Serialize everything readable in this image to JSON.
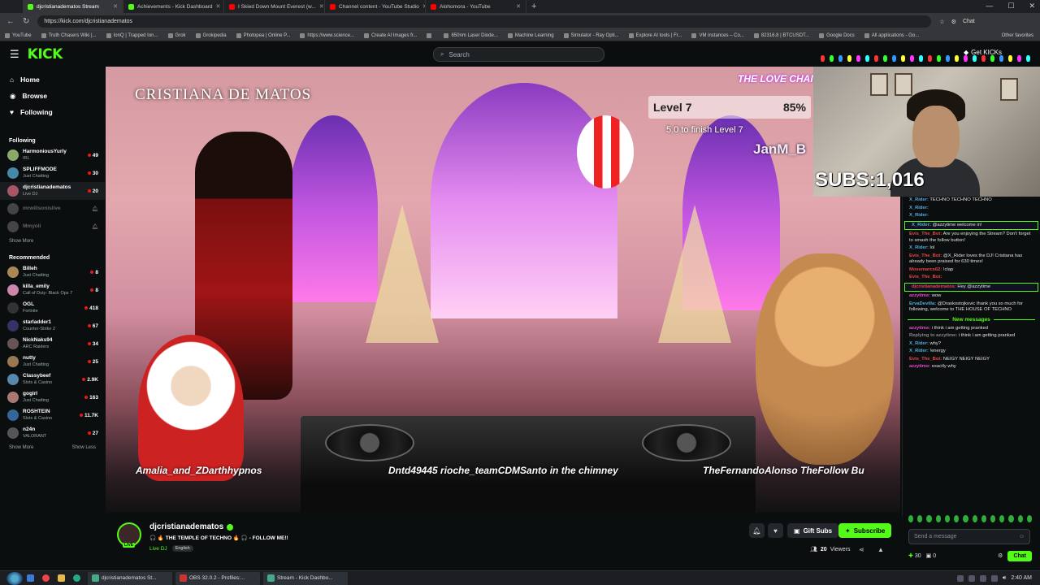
{
  "browser": {
    "tabs": [
      {
        "label": "djcristianadematos Stream",
        "color": "#53fc18",
        "active": true
      },
      {
        "label": "Achievements - Kick Dashboard",
        "color": "#53fc18"
      },
      {
        "label": "I Skied Down Mount Everest (w...",
        "color": "#ff0000"
      },
      {
        "label": "Channel content - YouTube Studio",
        "color": "#ff0000"
      },
      {
        "label": "Alohomora - YouTube",
        "color": "#ff0000"
      }
    ],
    "new_tab": "+",
    "url": "https://kick.com/djcristianadematos",
    "account_label": "Chat",
    "bookmarks": [
      "YouTube",
      "Truth Chasers Wiki |...",
      "IonQ | Trapped Ion...",
      "Grok",
      "Grokipedia",
      "Photopea | Online P...",
      "https://www.science...",
      "Create AI Images fr...",
      "",
      "650nm Laser Diode...",
      "Machine Learning",
      "Simulator - Ray Opti...",
      "Explore AI tools | Fr...",
      "VM instances – Co...",
      "82316.8 | BTCUSDT...",
      "Google Docs",
      "All applications - Go..."
    ],
    "other_favorites": "Other favorites"
  },
  "kick": {
    "logo": "KICK",
    "search_placeholder": "Search",
    "get_kicks": "Get KICKs",
    "nav": [
      {
        "label": "Home",
        "icon": "home-icon"
      },
      {
        "label": "Browse",
        "icon": "browse-icon"
      },
      {
        "label": "Following",
        "icon": "heart-icon"
      }
    ],
    "following_header": "Following",
    "following": [
      {
        "name": "HarmoniousYurly",
        "category": "IRL",
        "viewers": "49",
        "color": "#8a6"
      },
      {
        "name": "SPLIFFMODE",
        "category": "Just Chatting",
        "viewers": "30",
        "color": "#48a"
      },
      {
        "name": "djcristianadematos",
        "category": "Live DJ",
        "viewers": "20",
        "color": "#a56",
        "selected": true
      },
      {
        "name": "mrwillsonislive",
        "category": "",
        "viewers": "",
        "color": "#444",
        "offline": true
      },
      {
        "name": "Mmyoli",
        "category": "",
        "viewers": "",
        "color": "#444",
        "offline": true
      }
    ],
    "show_more": "Show More",
    "recommended_header": "Recommended",
    "recommended": [
      {
        "name": "Billeh",
        "category": "Just Chatting",
        "viewers": "8",
        "color": "#a85"
      },
      {
        "name": "killa_emily",
        "category": "Call of Duty: Black Ops 7",
        "viewers": "8",
        "color": "#c8a"
      },
      {
        "name": "OGL",
        "category": "Fortnite",
        "viewers": "418",
        "color": "#333"
      },
      {
        "name": "starladder1",
        "category": "Counter-Strike 2",
        "viewers": "67",
        "color": "#336"
      },
      {
        "name": "NickNaks94",
        "category": "ARC Raiders",
        "viewers": "34",
        "color": "#655"
      },
      {
        "name": "nutty",
        "category": "Just Chatting",
        "viewers": "25",
        "color": "#975"
      },
      {
        "name": "Classybeef",
        "category": "Slots & Casino",
        "viewers": "2.9K",
        "color": "#58a"
      },
      {
        "name": "gogirl",
        "category": "Just Chatting",
        "viewers": "163",
        "color": "#a77"
      },
      {
        "name": "ROSHTEIN",
        "category": "Slots & Casino",
        "viewers": "11.7K",
        "color": "#369"
      },
      {
        "name": "n24n",
        "category": "VALORANT",
        "viewers": "27",
        "color": "#555"
      }
    ],
    "show_more2": "Show More",
    "show_less": "Show Less"
  },
  "video": {
    "performer_name": "CRISTIANA DE MATOS",
    "level_label": "Level 7",
    "level_pct": "85%",
    "level_sub": "5.0 to finish Level 7",
    "love_chain": "THE LOVE CHAIN",
    "janm": "JanM_B",
    "subs_label": "SUBS:1,016",
    "ticker": [
      "Amalia_and_ZDarthhypnos",
      "Dntd49445 rioche_teamCDMSanto in the chimney",
      "TheFernandoAlonso TheFollow Bu"
    ]
  },
  "chat": {
    "messages": [
      {
        "user": "X_Rider:",
        "text": "TECHNO TECHNO TECHNO",
        "color": "#5ad"
      },
      {
        "user": "X_Rider:",
        "text": "",
        "color": "#5ad"
      },
      {
        "user": "X_Rider:",
        "text": "",
        "color": "#5ad"
      },
      {
        "user": "X_Rider:",
        "text": "@azzytime welcome in!",
        "color": "#5ad",
        "hl": true
      },
      {
        "user": "Evis_The_Bot:",
        "text": "Are you enjoying the Stream? Don't forget to smash the follow button!",
        "color": "#e44"
      },
      {
        "user": "X_Rider:",
        "text": "lol",
        "color": "#5ad"
      },
      {
        "user": "Evis_The_Bot:",
        "text": "@X_Rider loves the DJ! Cristiana has already been praised for 630 times!",
        "color": "#e44"
      },
      {
        "user": "Mosemarcs62:",
        "text": "!clap",
        "color": "#e44"
      },
      {
        "user": "Evis_The_Bot:",
        "text": "",
        "color": "#e44"
      },
      {
        "user": "djcristianadematos:",
        "text": "Hey @azzytime",
        "color": "#e44",
        "hl": true
      },
      {
        "user": "azzytime:",
        "text": "wow",
        "color": "#e4c"
      },
      {
        "user": "ErvaDevilla:",
        "text": "@Draskostojkovic thank you so much for following, welcome to THE HOUSE OF TECHNO",
        "color": "#5ad"
      }
    ],
    "new_messages": "New messages",
    "messages2": [
      {
        "user": "azzytime:",
        "text": "i think i am getting pranked",
        "color": "#e4c"
      },
      {
        "user": "Replying to azzytime:",
        "text": "i think i am getting pranked",
        "color": "#888"
      },
      {
        "user": "X_Rider:",
        "text": "why?",
        "color": "#5ad"
      },
      {
        "user": "X_Rider:",
        "text": "!energy",
        "color": "#5ad"
      },
      {
        "user": "Evis_The_Bot:",
        "text": "NEIGY NEIGY NEIGY",
        "color": "#e44"
      },
      {
        "user": "azzytime:",
        "text": "exactly why",
        "color": "#e4c"
      }
    ],
    "input_placeholder": "Send a message",
    "kicks": "30",
    "gifts": "0",
    "chat_button": "Chat"
  },
  "stream": {
    "channel": "djcristianadematos",
    "title": "🎧 🔥 THE TEMPLE OF TECHNO 🔥 🎧 - FOLLOW ME!!",
    "category": "Live DJ",
    "language": "English",
    "live": "LIVE",
    "gift_subs": "Gift Subs",
    "subscribe": "Subscribe",
    "viewers": "20",
    "viewers_label": "Viewers"
  },
  "taskbar": {
    "items": [
      "djcristianadematos St...",
      "OBS 32.0.2 - Profiles:...",
      "Stream - Kick Dashbo..."
    ],
    "time": "2:40 AM"
  }
}
